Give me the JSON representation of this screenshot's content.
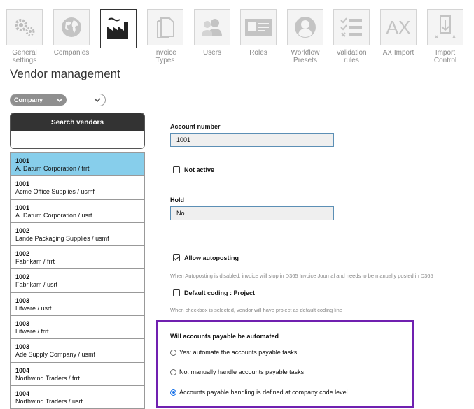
{
  "nav": {
    "items": [
      {
        "label": "General\nsettings",
        "icon": "gear-icon"
      },
      {
        "label": "Companies",
        "icon": "globe-icon"
      },
      {
        "label": "",
        "icon": "factory-icon"
      },
      {
        "label": "Invoice\nTypes",
        "icon": "documents-icon"
      },
      {
        "label": "Users",
        "icon": "users-icon"
      },
      {
        "label": "Roles",
        "icon": "id-card-icon"
      },
      {
        "label": "Workflow\nPresets",
        "icon": "user-circle-icon"
      },
      {
        "label": "Validation\nrules",
        "icon": "checklist-icon"
      },
      {
        "label": "AX Import",
        "icon": "ax-icon"
      },
      {
        "label": "Import\nControl",
        "icon": "import-icon"
      }
    ],
    "ax_text": "AX"
  },
  "page_title": "Vendor management",
  "company_filter": {
    "label": "Company"
  },
  "search": {
    "title": "Search vendors",
    "value": ""
  },
  "vendors": [
    {
      "id": "1001",
      "name": "A. Datum Corporation / frrt"
    },
    {
      "id": "1001",
      "name": "Acme Office Supplies / usmf"
    },
    {
      "id": "1001",
      "name": "A. Datum Corporation / usrt"
    },
    {
      "id": "1002",
      "name": "Lande Packaging Supplies / usmf"
    },
    {
      "id": "1002",
      "name": "Fabrikam / frrt"
    },
    {
      "id": "1002",
      "name": "Fabrikam / usrt"
    },
    {
      "id": "1003",
      "name": "Litware / usrt"
    },
    {
      "id": "1003",
      "name": "Litware / frrt"
    },
    {
      "id": "1003",
      "name": "Ade Supply Company / usmf"
    },
    {
      "id": "1004",
      "name": "Northwind Traders / frrt"
    },
    {
      "id": "1004",
      "name": "Northwind Traders / usrt"
    }
  ],
  "form": {
    "account_number_label": "Account number",
    "account_number_value": "1001",
    "not_active_label": "Not active",
    "hold_label": "Hold",
    "hold_value": "No",
    "allow_autoposting_label": "Allow autoposting",
    "autoposting_hint": "When Autoposting is disabled, invoice will stop in D365 Invoice Journal and needs to be manually posted in D365",
    "default_coding_label": "Default coding : Project",
    "default_coding_hint": "When checkbox is selected, vendor will have project as default coding line",
    "ap_title": "Will accounts payable be automated",
    "ap_options": [
      "Yes: automate the accounts payable tasks",
      "No: manually handle accounts payable tasks",
      "Accounts payable handling is defined at company code level"
    ]
  },
  "colors": {
    "selected_row": "#87ceeb",
    "highlight_border": "#7020b0",
    "header_dark": "#333333"
  }
}
